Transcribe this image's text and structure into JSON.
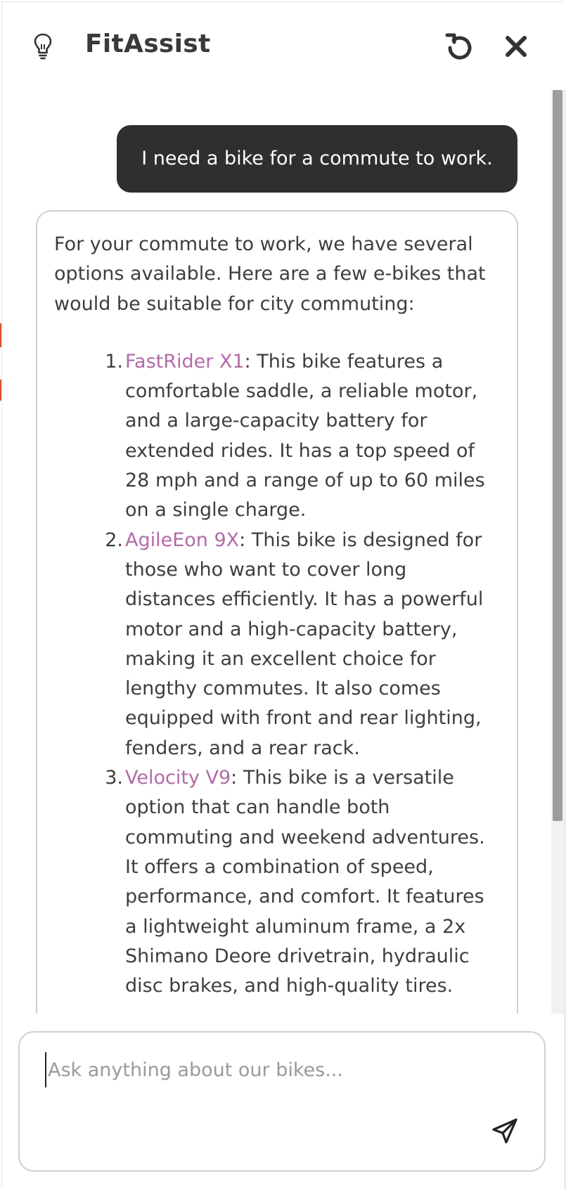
{
  "header": {
    "title": "FitAssist",
    "tip_icon": "lightbulb-icon",
    "reset_icon": "refresh-icon",
    "close_icon": "close-icon"
  },
  "conversation": {
    "user_message": "I need a bike for a commute to work.",
    "bot_intro": "For your commute to work, we have several options available. Here are a few e-bikes that would be suitable for city commuting:",
    "bikes": [
      {
        "number": "1.",
        "name": "FastRider X1",
        "description": ": This bike features a comfortable saddle, a reliable motor, and a large-capacity battery for extended rides. It has a top speed of 28 mph and a range of up to 60 miles on a single charge."
      },
      {
        "number": "2.",
        "name": "AgileEon 9X",
        "description": ": This bike is designed for those who want to cover long distances efficiently. It has a powerful motor and a high-capacity battery, making it an excellent choice for lengthy commutes. It also comes equipped with front and rear lighting, fenders, and a rear rack."
      },
      {
        "number": "3.",
        "name": "Velocity V9",
        "description": ": This bike is a versatile option that can handle both commuting and weekend adventures. It offers a combination of speed, performance, and comfort. It features a lightweight aluminum frame, a 2x Shimano Deore drivetrain, hydraulic disc brakes, and high-quality tires."
      }
    ]
  },
  "composer": {
    "placeholder": "Ask anything about our bikes...",
    "value": "",
    "send_icon": "send-icon"
  },
  "colors": {
    "accent_link": "#b36aa8",
    "user_bubble": "#2f2f2f",
    "text": "#3a3a3a"
  }
}
